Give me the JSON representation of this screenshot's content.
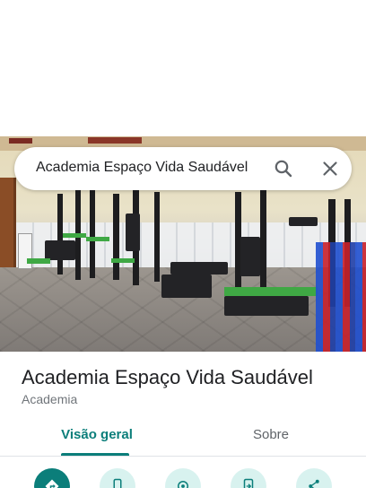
{
  "search": {
    "query": "Academia Espaço Vida Saudável",
    "search_icon": "search-icon",
    "close_icon": "close-icon"
  },
  "place": {
    "name": "Academia Espaço Vida Saudável",
    "category": "Academia"
  },
  "tabs": [
    {
      "label": "Visão geral",
      "active": true
    },
    {
      "label": "Sobre",
      "active": false
    }
  ],
  "actions": [
    {
      "icon": "directions-icon"
    },
    {
      "icon": "phone-icon"
    },
    {
      "icon": "location-icon"
    },
    {
      "icon": "send-to-phone-icon"
    },
    {
      "icon": "share-icon"
    }
  ],
  "colors": {
    "accent": "#0b7e7a",
    "action_background": "#d8f2ef",
    "text_primary": "#202124",
    "text_secondary": "#70757a"
  }
}
